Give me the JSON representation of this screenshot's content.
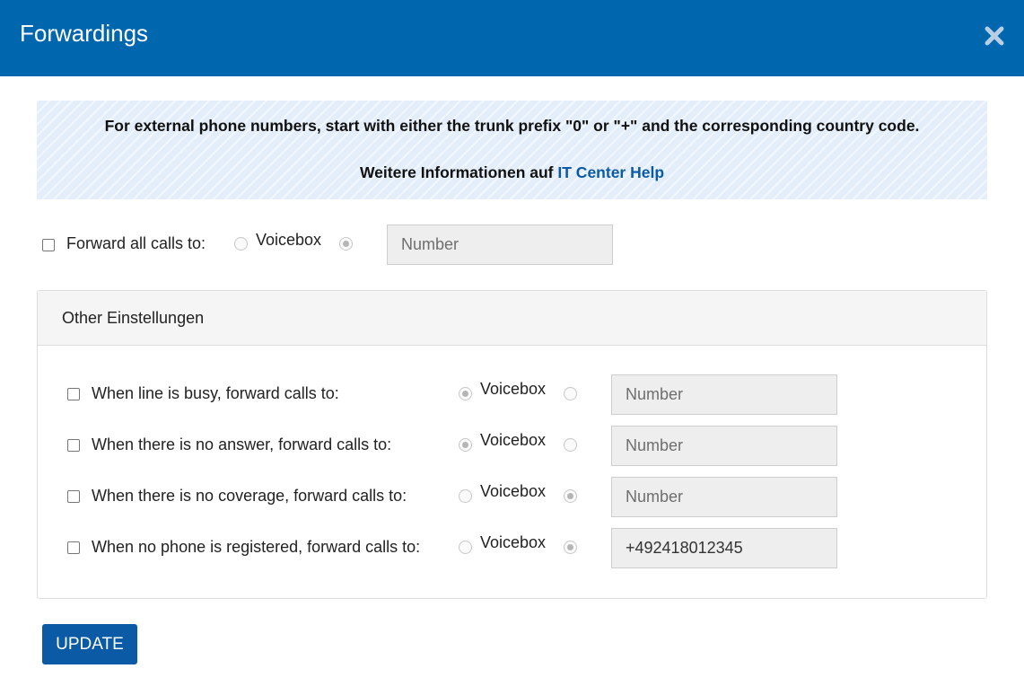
{
  "dialog": {
    "title": "Forwardings",
    "close_icon": "close-icon"
  },
  "info": {
    "text": "For external phone numbers, start with either the trunk prefix \"0\" or \"+\" and the corresponding country code.",
    "more_prefix": "Weitere Informationen auf",
    "link_label": "IT Center Help"
  },
  "forward_all": {
    "label": "Forward all calls to:",
    "checked": false,
    "voicebox_label": "Voicebox",
    "selected": "number",
    "number_placeholder": "Number",
    "number_value": ""
  },
  "panel": {
    "title": "Other Einstellungen",
    "rows": [
      {
        "label": "When line is busy, forward calls to:",
        "checked": false,
        "voicebox_label": "Voicebox",
        "selected": "voicebox",
        "number_placeholder": "Number",
        "number_value": ""
      },
      {
        "label": "When there is no answer, forward calls to:",
        "checked": false,
        "voicebox_label": "Voicebox",
        "selected": "voicebox",
        "number_placeholder": "Number",
        "number_value": ""
      },
      {
        "label": "When there is no coverage, forward calls to:",
        "checked": false,
        "voicebox_label": "Voicebox",
        "selected": "number",
        "number_placeholder": "Number",
        "number_value": ""
      },
      {
        "label": "When no phone is registered, forward calls to:",
        "checked": false,
        "voicebox_label": "Voicebox",
        "selected": "number",
        "number_placeholder": "Number",
        "number_value": "+492418012345"
      }
    ]
  },
  "actions": {
    "update_label": "UPDATE"
  },
  "colors": {
    "header": "#0066ad",
    "button": "#0a5aa6",
    "link": "#0a5aa6",
    "info_bg": "#e3eefa"
  }
}
